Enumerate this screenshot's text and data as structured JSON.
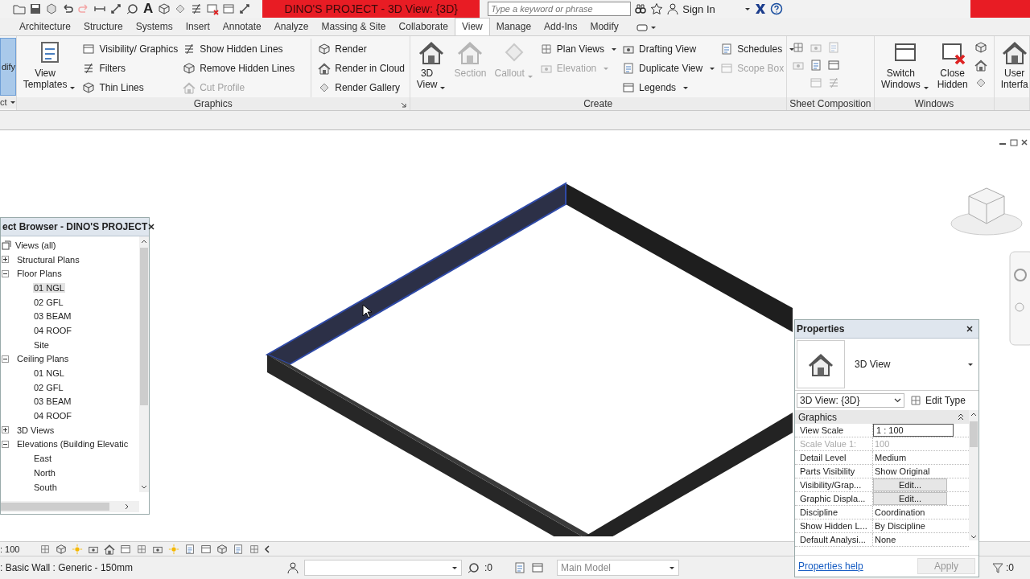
{
  "title_bar": {
    "quick_access_letter": "A",
    "title": "DINO'S PROJECT - 3D View: {3D}",
    "search": {
      "placeholder": "Type a keyword or phrase"
    },
    "sign_in": "Sign In"
  },
  "tabs": [
    {
      "label": "Architecture",
      "selected": false
    },
    {
      "label": "Structure",
      "selected": false
    },
    {
      "label": "Systems",
      "selected": false
    },
    {
      "label": "Insert",
      "selected": false
    },
    {
      "label": "Annotate",
      "selected": false
    },
    {
      "label": "Analyze",
      "selected": false
    },
    {
      "label": "Massing & Site",
      "selected": false
    },
    {
      "label": "Collaborate",
      "selected": false
    },
    {
      "label": "View",
      "selected": true
    },
    {
      "label": "Manage",
      "selected": false
    },
    {
      "label": "Add-Ins",
      "selected": false
    },
    {
      "label": "Modify",
      "selected": false
    }
  ],
  "ribbon": {
    "modify": {
      "label": "dify",
      "panel": "ct"
    },
    "panels": [
      {
        "title": "Graphics",
        "launcher": true,
        "columns": [
          {
            "kind": "large",
            "items": [
              {
                "label": "View Templates",
                "disabled": false,
                "dropdown": true
              }
            ]
          },
          {
            "kind": "small",
            "items": [
              {
                "label": "Visibility/ Graphics",
                "disabled": false
              },
              {
                "label": "Filters",
                "disabled": false
              },
              {
                "label": "Thin Lines",
                "disabled": false
              }
            ]
          },
          {
            "kind": "small",
            "items": [
              {
                "label": "Show Hidden Lines",
                "disabled": false
              },
              {
                "label": "Remove Hidden Lines",
                "disabled": false
              },
              {
                "label": "Cut Profile",
                "disabled": true
              }
            ]
          },
          {
            "kind": "small",
            "items": [
              {
                "label": "Render",
                "disabled": false
              },
              {
                "label": "Render in Cloud",
                "disabled": false
              },
              {
                "label": "Render Gallery",
                "disabled": false
              }
            ]
          }
        ]
      },
      {
        "title": "Create",
        "columns": [
          {
            "kind": "large",
            "items": [
              {
                "label": "3D View",
                "disabled": false,
                "dropdown": true
              }
            ]
          },
          {
            "kind": "large",
            "items": [
              {
                "label": "Section",
                "disabled": true
              }
            ]
          },
          {
            "kind": "large",
            "items": [
              {
                "label": "Callout",
                "disabled": true,
                "dropdown": true
              }
            ]
          },
          {
            "kind": "small",
            "items": [
              {
                "label": "Plan Views",
                "disabled": false,
                "dropdown": true
              },
              {
                "label": "Elevation",
                "disabled": true,
                "dropdown": true
              }
            ]
          },
          {
            "kind": "small",
            "items": [
              {
                "label": "Drafting View",
                "disabled": false
              },
              {
                "label": "Duplicate View",
                "disabled": false,
                "dropdown": true
              },
              {
                "label": "Legends",
                "disabled": false,
                "dropdown": true
              }
            ]
          },
          {
            "kind": "small",
            "items": [
              {
                "label": "Schedules",
                "disabled": false,
                "dropdown": true
              },
              {
                "label": "Scope Box",
                "disabled": true
              }
            ]
          }
        ]
      },
      {
        "title": "Sheet Composition",
        "columns": [
          {
            "kind": "icons",
            "items": [
              {
                "disabled": false
              },
              {
                "disabled": true
              }
            ]
          },
          {
            "kind": "icons",
            "items": [
              {
                "disabled": true
              },
              {
                "disabled": false
              },
              {
                "disabled": true
              }
            ]
          },
          {
            "kind": "icons",
            "items": [
              {
                "disabled": true
              },
              {
                "disabled": false
              },
              {
                "disabled": true
              }
            ]
          }
        ]
      },
      {
        "title": "Windows",
        "columns": [
          {
            "kind": "large",
            "items": [
              {
                "label": "Switch Windows",
                "disabled": false,
                "dropdown": true
              }
            ]
          },
          {
            "kind": "large",
            "items": [
              {
                "label": "Close Hidden",
                "disabled": false
              }
            ]
          },
          {
            "kind": "icons",
            "items": [
              {
                "disabled": false
              },
              {
                "disabled": false
              },
              {
                "disabled": false
              }
            ]
          }
        ]
      },
      {
        "columns": [
          {
            "kind": "large",
            "items": [
              {
                "label": "User Interfa",
                "disabled": false
              }
            ]
          }
        ]
      }
    ]
  },
  "project_browser": {
    "title": "ect Browser - DINO'S PROJECT",
    "tree": [
      {
        "label": "Views (all)",
        "selected": false,
        "children": [
          {
            "label": "Structural Plans",
            "expanded": false,
            "selected": false
          },
          {
            "label": "Floor Plans",
            "expanded": true,
            "selected": false,
            "children": [
              {
                "label": "01 NGL",
                "selected": true
              },
              {
                "label": "02 GFL",
                "selected": false
              },
              {
                "label": "03 BEAM",
                "selected": false
              },
              {
                "label": "04 ROOF",
                "selected": false
              },
              {
                "label": "Site",
                "selected": false
              }
            ]
          },
          {
            "label": "Ceiling Plans",
            "expanded": true,
            "selected": false,
            "children": [
              {
                "label": "01 NGL",
                "selected": false
              },
              {
                "label": "02 GFL",
                "selected": false
              },
              {
                "label": "03 BEAM",
                "selected": false
              },
              {
                "label": "04 ROOF",
                "selected": false
              }
            ]
          },
          {
            "label": "3D Views",
            "expanded": false,
            "selected": false
          },
          {
            "label": "Elevations (Building Elevatic",
            "expanded": true,
            "selected": false,
            "children": [
              {
                "label": "East",
                "selected": false
              },
              {
                "label": "North",
                "selected": false
              },
              {
                "label": "South",
                "selected": false
              }
            ]
          }
        ]
      }
    ]
  },
  "properties": {
    "title": "Properties",
    "type_name": "3D View",
    "instance": "3D View: {3D}",
    "edit_type": "Edit Type",
    "group": {
      "label": "Graphics",
      "expanded": true
    },
    "rows": [
      {
        "name": "View Scale",
        "value": "1 : 100",
        "kind": "input",
        "disabled": false
      },
      {
        "name": "Scale Value    1:",
        "value": "100",
        "kind": "text",
        "disabled": true
      },
      {
        "name": "Detail Level",
        "value": "Medium",
        "kind": "text",
        "disabled": false
      },
      {
        "name": "Parts Visibility",
        "value": "Show Original",
        "kind": "text",
        "disabled": false
      },
      {
        "name": "Visibility/Grap...",
        "value": "Edit...",
        "kind": "button",
        "disabled": false
      },
      {
        "name": "Graphic Displa...",
        "value": "Edit...",
        "kind": "button",
        "disabled": false
      },
      {
        "name": "Discipline",
        "value": "Coordination",
        "kind": "text",
        "disabled": false
      },
      {
        "name": "Show Hidden L...",
        "value": "By Discipline",
        "kind": "text",
        "disabled": false
      },
      {
        "name": "Default Analysi...",
        "value": "None",
        "kind": "text",
        "disabled": false
      }
    ],
    "help_link": "Properties help",
    "apply": {
      "label": "Apply",
      "disabled": true
    }
  },
  "view_bar": {
    "scale": ": 100"
  },
  "status_bar": {
    "message": ": Basic Wall : Generic - 150mm",
    "worksets": ":0",
    "model": "Main Model",
    "filter": ":0"
  }
}
